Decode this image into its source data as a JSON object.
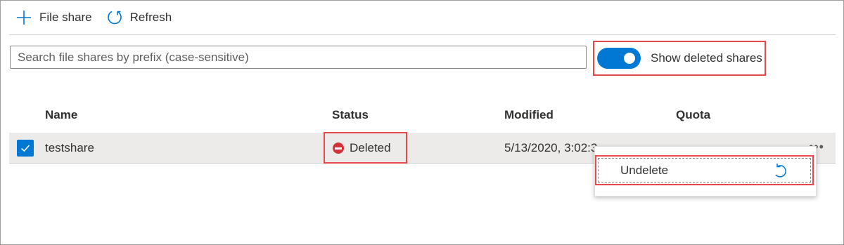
{
  "toolbar": {
    "add_icon": "plus-icon",
    "add_label": "File share",
    "refresh_icon": "refresh-icon",
    "refresh_label": "Refresh"
  },
  "search": {
    "placeholder": "Search file shares by prefix (case-sensitive)",
    "value": ""
  },
  "toggle": {
    "label": "Show deleted shares",
    "on": true
  },
  "table": {
    "columns": [
      "Name",
      "Status",
      "Modified",
      "Quota"
    ],
    "rows": [
      {
        "selected": true,
        "name": "testshare",
        "status": "Deleted",
        "status_icon": "deleted-status-icon",
        "modified": "5/13/2020, 3:02:3",
        "quota": "",
        "more_label": "•••"
      }
    ]
  },
  "context_menu": {
    "items": [
      {
        "label": "Undelete",
        "icon": "undo-icon"
      }
    ]
  },
  "colors": {
    "accent": "#0078d4",
    "highlight_border": "#e8474c",
    "deleted_status": "#d13438",
    "selected_row": "#edebe9"
  }
}
